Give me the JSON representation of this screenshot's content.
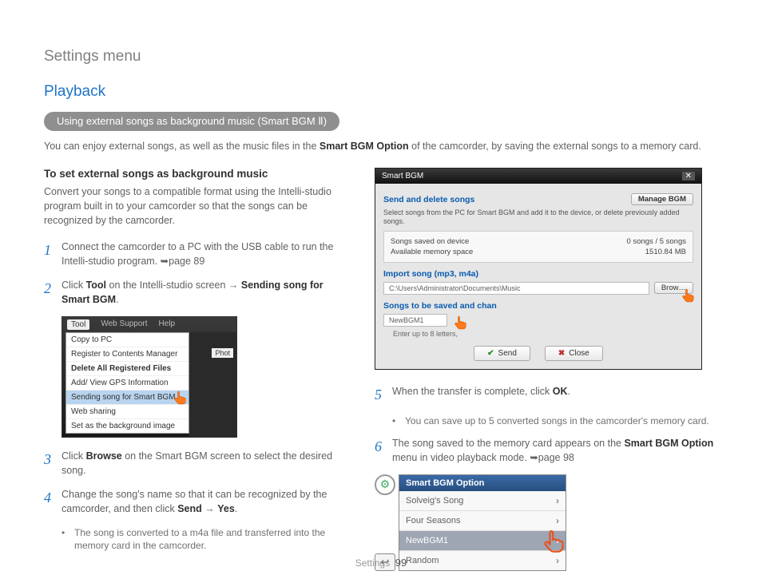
{
  "page": {
    "title": "Settings menu",
    "section": "Playback",
    "pill": "Using external songs as background music (Smart BGM Ⅱ)",
    "intro_pre": "You can enjoy external songs, as well as the music files in the ",
    "intro_bold": "Smart BGM Option",
    "intro_post": " of the camcorder, by saving the external songs to a memory card.",
    "footer_label": "Settings",
    "footer_page": "99"
  },
  "left": {
    "subheading": "To set external songs as background music",
    "para": "Convert your songs to a compatible format using the Intelli-studio program built in to your camcorder so that the songs can be recognized by the camcorder.",
    "step1": "Connect the camcorder to a PC with the USB cable to run the Intelli-studio program. ➥page 89",
    "step2_pre": "Click ",
    "step2_b1": "Tool",
    "step2_mid": " on the Intelli-studio screen → ",
    "step2_b2": "Sending song for Smart BGM",
    "step2_post": ".",
    "step3_pre": "Click ",
    "step3_b": "Browse",
    "step3_post": " on the Smart BGM screen to select the desired song.",
    "step4_pre": "Change the song's name so that it can be recognized by the camcorder, and then click ",
    "step4_b1": "Send",
    "step4_mid": " → ",
    "step4_b2": "Yes",
    "step4_post": ".",
    "bullet4": "The song is converted to a m4a file and transferred into the memory card in the camcorder."
  },
  "right": {
    "step5_pre": "When the transfer is complete, click ",
    "step5_b": "OK",
    "step5_post": ".",
    "bullet5": "You can save up to 5 converted songs in the camcorder's memory card.",
    "step6_pre": "The song saved to the memory card appears on the ",
    "step6_b": "Smart BGM Option",
    "step6_post": " menu in video playback mode. ➥page 98"
  },
  "ss1": {
    "menubar": {
      "tool": "Tool",
      "web": "Web Support",
      "help": "Help"
    },
    "items": {
      "copy": "Copy to PC",
      "register": "Register to Contents Manager",
      "delete": "Delete All Registered Files",
      "gps": "Add/ View GPS Information",
      "send": "Sending song for Smart BGM",
      "share": "Web sharing",
      "setbg": "Set as the background image"
    },
    "side": "Phot"
  },
  "ss2": {
    "title": "Smart BGM",
    "g1_title": "Send and delete songs",
    "manage": "Manage BGM",
    "g1_desc": "Select songs from the PC for Smart BGM and add it to the device, or delete previously added songs.",
    "row1_l": "Songs saved on device",
    "row1_r": "0 songs / 5 songs",
    "row2_l": "Available memory space",
    "row2_r": "1510.84 MB",
    "g2_title": "Import song (mp3, m4a)",
    "path": "C:\\Users\\Administrator\\Documents\\Music",
    "browse": "Brow…",
    "g3_title": "Songs to be saved and chan",
    "newname": "NewBGM1",
    "hint": "Enter up to 8 letters,",
    "send": "Send",
    "close": "Close"
  },
  "ss3": {
    "header": "Smart BGM Option",
    "i1": "Solveig's Song",
    "i2": "Four Seasons",
    "i3": "NewBGM1",
    "i4": "Random"
  }
}
